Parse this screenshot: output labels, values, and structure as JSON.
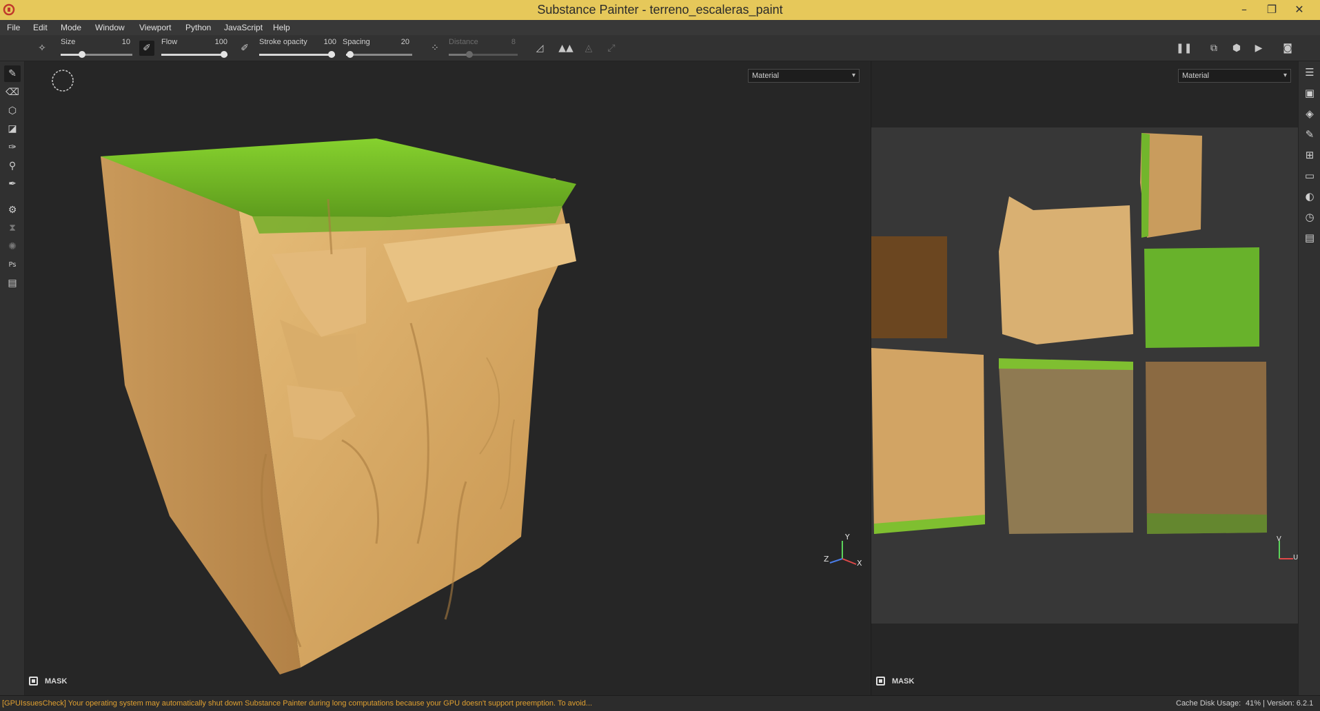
{
  "window": {
    "title": "Substance Painter - terreno_escaleras_paint",
    "minimize": "–",
    "maximize": "❐",
    "close": "✕"
  },
  "menu": [
    "File",
    "Edit",
    "Mode",
    "Window",
    "Viewport",
    "Python",
    "JavaScript",
    "Help"
  ],
  "tool_options": {
    "size_label": "Size",
    "size_value": "10",
    "size_level": 0.3,
    "flow_label": "Flow",
    "flow_value": "100",
    "flow_level": 1.0,
    "stroke_opacity_label": "Stroke opacity",
    "stroke_opacity_value": "100",
    "stroke_opacity_level": 1.0,
    "spacing_label": "Spacing",
    "spacing_value": "20",
    "spacing_level": 0.06,
    "distance_label": "Distance",
    "distance_value": "8",
    "distance_level": 0.3
  },
  "viewport_3d": {
    "mode": "Material",
    "mask_label": "MASK",
    "axis_y": "Y",
    "axis_z": "Z",
    "axis_x": "X"
  },
  "viewport_2d": {
    "mode": "Material",
    "mask_label": "MASK",
    "axis_v": "V",
    "axis_u": "U"
  },
  "status": {
    "warning": "[GPUIssuesCheck] Your operating system may automatically shut down Substance Painter during long computations because your GPU doesn't support preemption. To avoid...",
    "cache_label": "Cache Disk Usage:",
    "cache_value": "41% | Version: 6.2.1"
  },
  "colors": {
    "titlebar": "#e6c85a",
    "grass": "#7cc22c",
    "sand": "#d7ad6c",
    "warning": "#e0a030"
  },
  "icons": {
    "left": [
      "brush-icon",
      "eraser-icon",
      "projection-icon",
      "polygon-fill-icon",
      "smudge-icon",
      "clone-stamp-icon",
      "color-picker-icon",
      "bake-icon",
      "hourglass-icon",
      "iray-icon",
      "photoshop-icon",
      "export-icon"
    ],
    "right": [
      "layers-panel-icon",
      "texture-set-icon",
      "layer-stack-icon",
      "brush-settings-icon",
      "shelf-icon",
      "display-settings-icon",
      "viewer-settings-icon",
      "history-icon",
      "log-icon"
    ]
  }
}
